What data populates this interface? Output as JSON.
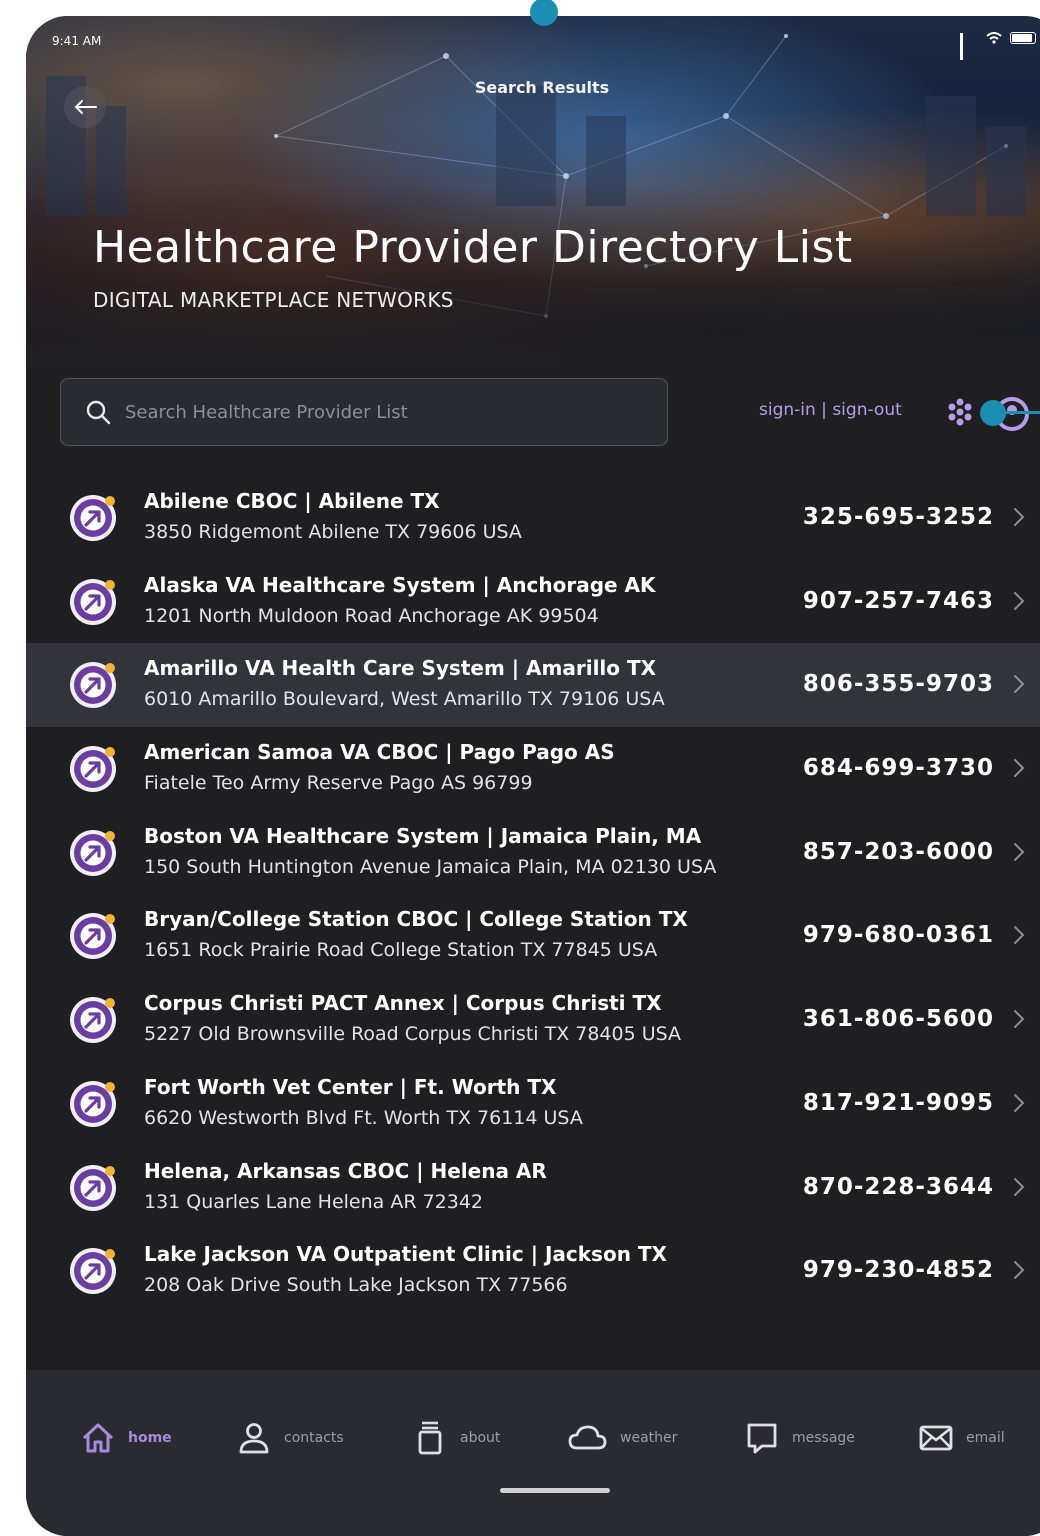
{
  "status": {
    "time": "9:41 AM"
  },
  "header": {
    "screen_title": "Search Results",
    "title": "Healthcare Provider Directory List",
    "subtitle": "DIGITAL MARKETPLACE NETWORKS"
  },
  "search": {
    "placeholder": "Search Healthcare Provider List",
    "value": ""
  },
  "auth": {
    "sign_in": "sign-in",
    "separator": " | ",
    "sign_out": "sign-out"
  },
  "providers": [
    {
      "name": "Abilene CBOC | Abilene TX",
      "address": "3850 Ridgemont Abilene TX 79606 USA",
      "phone": "325-695-3252"
    },
    {
      "name": "Alaska VA Healthcare System | Anchorage AK",
      "address": "1201 North Muldoon Road Anchorage AK 99504",
      "phone": "907-257-7463"
    },
    {
      "name": "Amarillo VA Health Care System | Amarillo TX",
      "address": "6010 Amarillo Boulevard, West Amarillo TX 79106 USA",
      "phone": "806-355-9703"
    },
    {
      "name": "American Samoa VA CBOC | Pago Pago AS",
      "address": "Fiatele Teo Army Reserve Pago AS 96799",
      "phone": "684-699-3730"
    },
    {
      "name": "Boston VA Healthcare System | Jamaica Plain, MA",
      "address": "150 South Huntington Avenue Jamaica Plain, MA 02130 USA",
      "phone": "857-203-6000"
    },
    {
      "name": "Bryan/College Station CBOC | College Station TX",
      "address": "1651 Rock Prairie Road College Station TX 77845 USA",
      "phone": "979-680-0361"
    },
    {
      "name": "Corpus Christi PACT Annex | Corpus Christi TX",
      "address": "5227 Old Brownsville Road Corpus Christi TX 78405 USA",
      "phone": "361-806-5600"
    },
    {
      "name": "Fort Worth Vet Center | Ft. Worth TX",
      "address": "6620 Westworth Blvd Ft. Worth TX 76114 USA",
      "phone": "817-921-9095"
    },
    {
      "name": "Helena, Arkansas CBOC | Helena AR",
      "address": "131 Quarles Lane Helena AR 72342",
      "phone": "870-228-3644"
    },
    {
      "name": "Lake Jackson VA Outpatient Clinic | Jackson TX",
      "address": "208 Oak Drive South Lake Jackson TX 77566",
      "phone": "979-230-4852"
    }
  ],
  "selected_row": 2,
  "tabs": [
    {
      "label": "home",
      "icon": "home-icon"
    },
    {
      "label": "contacts",
      "icon": "person-icon"
    },
    {
      "label": "about",
      "icon": "cup-icon"
    },
    {
      "label": "weather",
      "icon": "cloud-icon"
    },
    {
      "label": "message",
      "icon": "chat-bubble-icon"
    },
    {
      "label": "email",
      "icon": "envelope-icon"
    }
  ],
  "colors": {
    "accent": "#a78be0",
    "link": "#b89ce8",
    "background": "#1f1f22",
    "avatar_ring": "#6a3ea1",
    "avatar_dot": "#f2b233",
    "editor_marker": "#1b8fb2"
  }
}
